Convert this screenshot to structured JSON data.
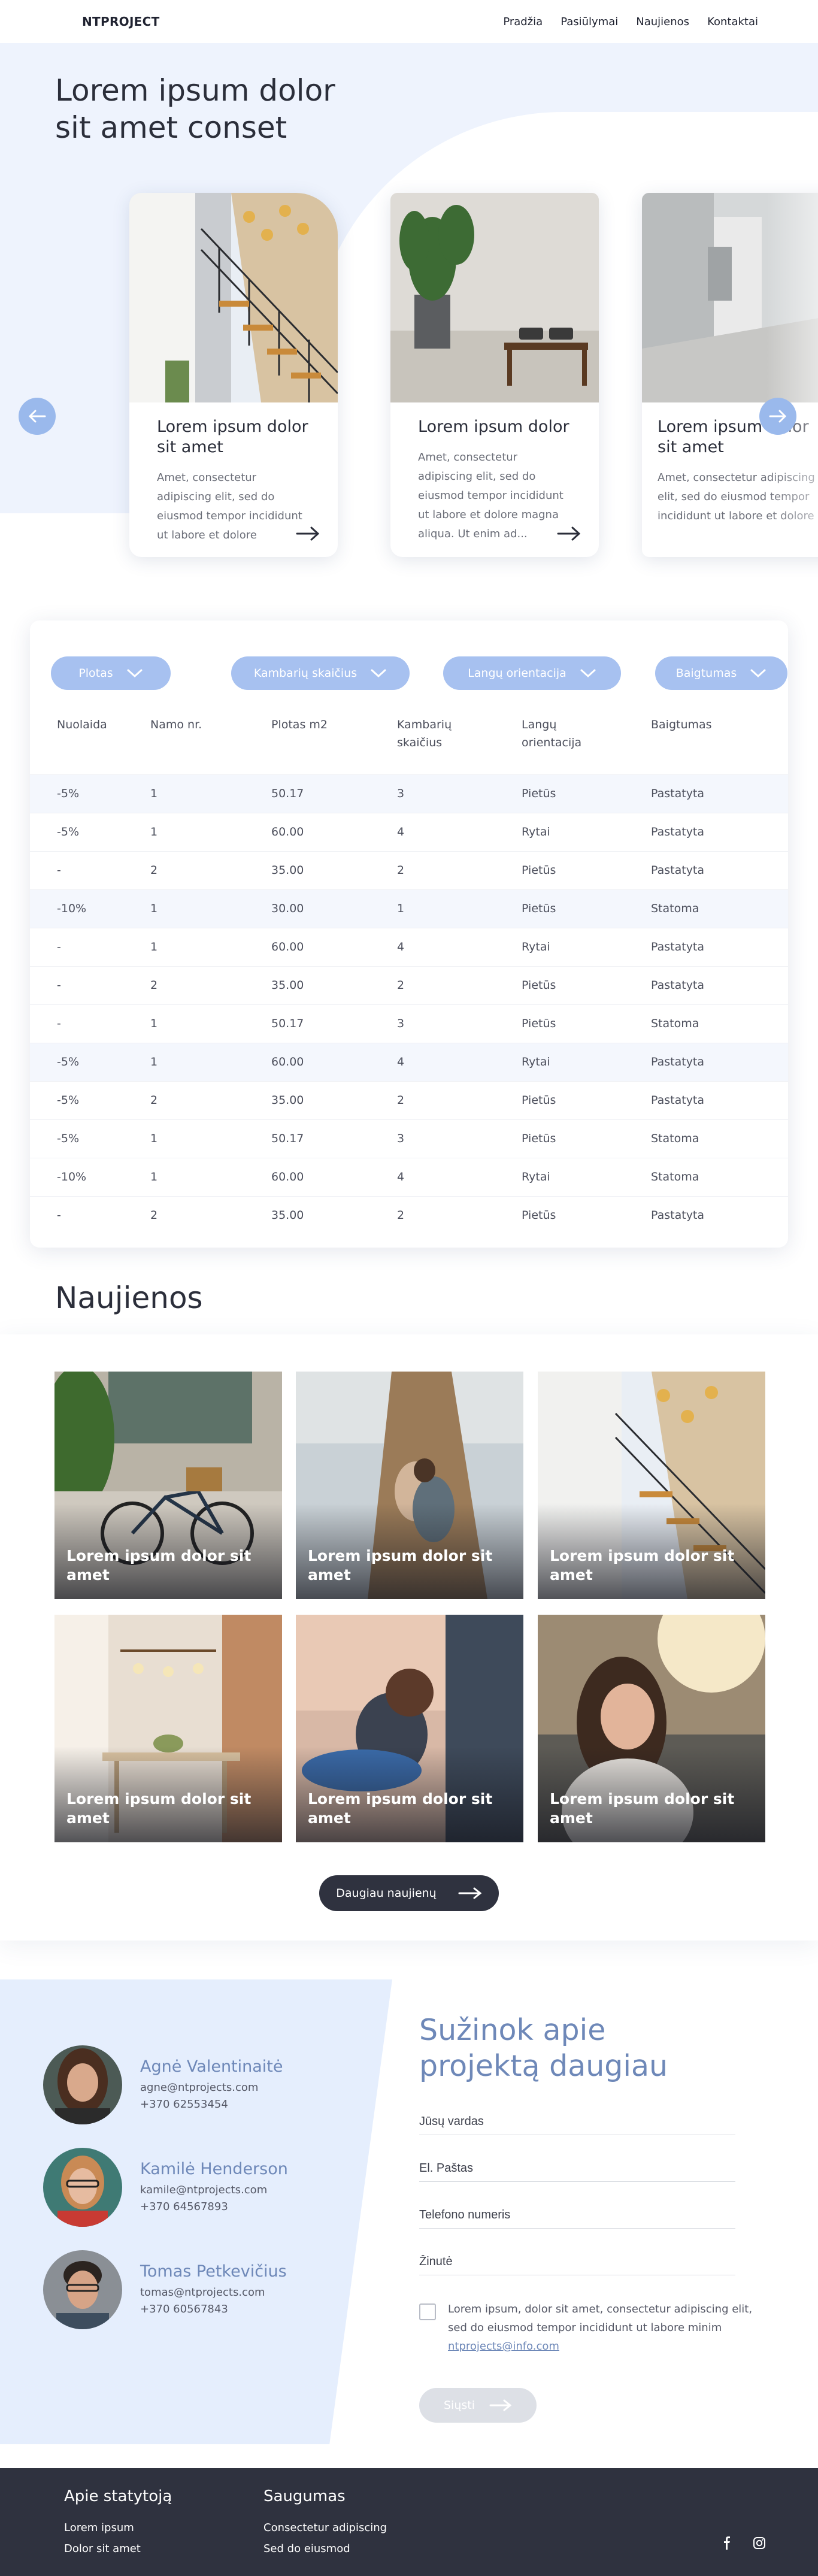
{
  "nav": {
    "logo": "NTPROJECT",
    "items": [
      "Pradžia",
      "Pasiūlymai",
      "Naujienos",
      "Kontaktai"
    ]
  },
  "hero": {
    "title": "Lorem ipsum dolor sit amet conset",
    "cards": [
      {
        "title": "Lorem ipsum dolor sit amet",
        "text": "Amet, consectetur adipiscing elit, sed do eiusmod tempor incididunt ut labore et dolore"
      },
      {
        "title": "Lorem ipsum dolor",
        "text": "Amet, consectetur adipiscing elit, sed do eiusmod tempor incididunt ut labore et dolore magna aliqua. Ut enim ad..."
      },
      {
        "title": "Lorem ipsum dolor sit amet",
        "text": "Amet, consectetur adipiscing elit, sed do eiusmod tempor incididunt ut labore et dolore"
      }
    ],
    "icons": {
      "prev": "arrow-left-icon",
      "next": "arrow-right-icon"
    }
  },
  "filters": [
    "Plotas",
    "Kambarių skaičius",
    "Langų orientacija",
    "Baigtumas"
  ],
  "table": {
    "headers": [
      "Nuolaida",
      "Namo nr.",
      "Plotas m2",
      "Kambarių skaičius",
      "Langų orientacija",
      "Baigtumas"
    ],
    "rows": [
      [
        "-5%",
        "1",
        "50.17",
        "3",
        "Pietūs",
        "Pastatyta"
      ],
      [
        "-5%",
        "1",
        "60.00",
        "4",
        "Rytai",
        "Pastatyta"
      ],
      [
        "-",
        "2",
        "35.00",
        "2",
        "Pietūs",
        "Pastatyta"
      ],
      [
        "-10%",
        "1",
        "30.00",
        "1",
        "Pietūs",
        "Statoma"
      ],
      [
        "-",
        "1",
        "60.00",
        "4",
        "Rytai",
        "Pastatyta"
      ],
      [
        "-",
        "2",
        "35.00",
        "2",
        "Pietūs",
        "Pastatyta"
      ],
      [
        "-",
        "1",
        "50.17",
        "3",
        "Pietūs",
        "Statoma"
      ],
      [
        "-5%",
        "1",
        "60.00",
        "4",
        "Rytai",
        "Pastatyta"
      ],
      [
        "-5%",
        "2",
        "35.00",
        "2",
        "Pietūs",
        "Pastatyta"
      ],
      [
        "-5%",
        "1",
        "50.17",
        "3",
        "Pietūs",
        "Statoma"
      ],
      [
        "-10%",
        "1",
        "60.00",
        "4",
        "Rytai",
        "Statoma"
      ],
      [
        "-",
        "2",
        "35.00",
        "2",
        "Pietūs",
        "Pastatyta"
      ]
    ]
  },
  "news": {
    "title": "Naujienos",
    "tiles": [
      "Lorem ipsum dolor sit amet",
      "Lorem ipsum dolor sit amet",
      "Lorem ipsum dolor sit amet",
      "Lorem ipsum dolor sit amet",
      "Lorem ipsum dolor sit amet",
      "Lorem ipsum dolor sit amet"
    ],
    "more_label": "Daugiau naujienų"
  },
  "contacts": [
    {
      "name": "Agnė Valentinaitė",
      "email": "agne@ntprojects.com",
      "phone": "+370 62553454"
    },
    {
      "name": "Kamilė Henderson",
      "email": "kamile@ntprojects.com",
      "phone": "+370 64567893"
    },
    {
      "name": "Tomas Petkevičius",
      "email": "tomas@ntprojects.com",
      "phone": "+370 60567843"
    }
  ],
  "form": {
    "title": "Sužinok apie projektą daugiau",
    "fields": [
      "Jūsų vardas",
      "El. Paštas",
      "Telefono numeris",
      "Žinutė"
    ],
    "consent_text": "Lorem ipsum, dolor sit amet, consectetur adipiscing elit, sed do eiusmod tempor incididunt ut labore minim",
    "consent_link": "ntprojects@info.com",
    "send_label": "Siųsti"
  },
  "footer": {
    "col1": {
      "title": "Apie statytoją",
      "links": [
        "Lorem ipsum",
        "Dolor sit amet"
      ]
    },
    "col2": {
      "title": "Saugumas",
      "links": [
        "Consectetur adipiscing",
        "Sed do eiusmod"
      ]
    },
    "social": [
      "facebook-icon",
      "instagram-icon"
    ]
  },
  "colors": {
    "accent": "#9ab9ec",
    "dark": "#2f323f",
    "heading_blue": "#6e88b8",
    "hero_bg": "#eef3fd",
    "contact_bg": "#e5eefd"
  }
}
